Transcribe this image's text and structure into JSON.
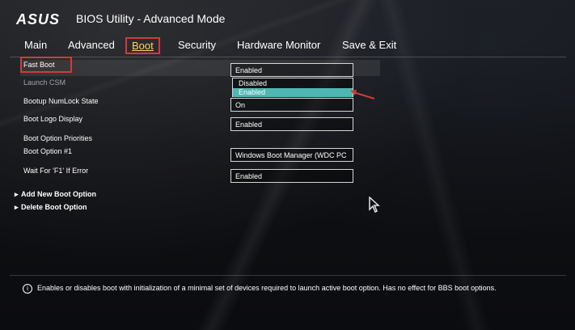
{
  "header": {
    "logo": "ASUS",
    "title": "BIOS Utility - Advanced Mode"
  },
  "tabs": [
    {
      "label": "Main"
    },
    {
      "label": "Advanced"
    },
    {
      "label": "Boot"
    },
    {
      "label": "Security"
    },
    {
      "label": "Hardware Monitor"
    },
    {
      "label": "Save & Exit"
    }
  ],
  "settings": {
    "fast_boot": {
      "label": "Fast Boot",
      "value": "Enabled"
    },
    "launch_csm": {
      "label": "Launch CSM"
    },
    "numlock": {
      "label": "Bootup NumLock State",
      "value": "On"
    },
    "boot_logo": {
      "label": "Boot Logo Display",
      "value": "Enabled"
    },
    "boot_priorities": {
      "label": "Boot Option Priorities"
    },
    "boot_option_1": {
      "label": "Boot Option #1",
      "value": "Windows Boot Manager (WDC PC"
    },
    "wait_f1": {
      "label": "Wait For 'F1' If Error",
      "value": "Enabled"
    }
  },
  "dropdown": {
    "options": [
      "Disabled",
      "Enabled"
    ],
    "selected": "Enabled"
  },
  "submenus": [
    {
      "label": "Add New Boot Option"
    },
    {
      "label": "Delete Boot Option"
    }
  ],
  "help": {
    "text": "Enables or disables boot with initialization of a minimal set of devices required to launch active boot option. Has no effect for BBS boot options."
  },
  "colors": {
    "accent_selected": "#4fb7b1",
    "annotation_red": "#d23a3a"
  },
  "icons": {
    "help": "info-icon",
    "submenu": "chevron-right-icon",
    "cursor": "mouse-cursor-icon"
  }
}
